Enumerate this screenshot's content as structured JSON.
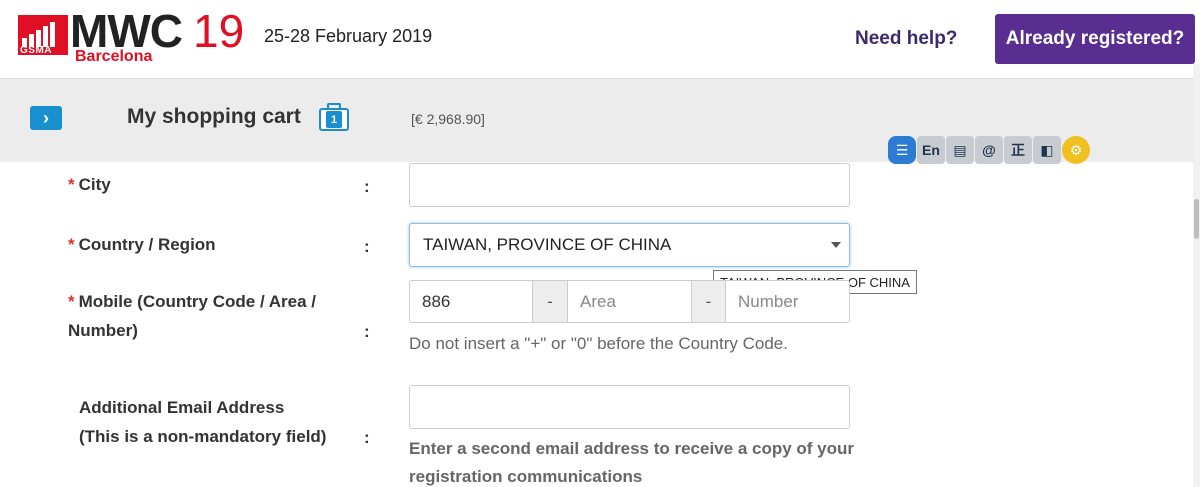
{
  "header": {
    "logo": {
      "org": "GSMA",
      "brand": "MWC",
      "year": "19",
      "city": "Barcelona"
    },
    "event_date": "25-28 February 2019",
    "need_help": "Need help?",
    "already_registered": "Already registered?"
  },
  "cart": {
    "title": "My shopping cart",
    "item_count": "1",
    "total": "[€ 2,968.90]"
  },
  "toolbar": {
    "items": [
      {
        "icon": "document-icon",
        "glyph": "☰"
      },
      {
        "icon": "english-icon",
        "glyph": "En"
      },
      {
        "icon": "list-icon",
        "glyph": "▤"
      },
      {
        "icon": "at-icon",
        "glyph": "@"
      },
      {
        "icon": "correct-icon",
        "glyph": "正"
      },
      {
        "icon": "contrast-icon",
        "glyph": "◧"
      },
      {
        "icon": "settings-icon",
        "glyph": "⚙"
      }
    ]
  },
  "form": {
    "city": {
      "required": "*",
      "label": "City",
      "colon": ":",
      "value": ""
    },
    "country": {
      "required": "*",
      "label": "Country / Region",
      "colon": ":",
      "value": "TAIWAN, PROVINCE OF CHINA",
      "tooltip": "TAIWAN, PROVINCE OF CHINA"
    },
    "mobile": {
      "required": "*",
      "label_line1": "Mobile (Country Code / Area /",
      "label_line2": "Number)",
      "colon": ":",
      "country_code": "886",
      "separator": "-",
      "area_placeholder": "Area",
      "number_placeholder": "Number",
      "help": "Do not insert a \"+\" or \"0\" before the Country Code."
    },
    "additional_email": {
      "label_line1": "Additional Email Address",
      "label_line2": "(This is a non-mandatory field)",
      "colon": ":",
      "value": "",
      "help_line1": "Enter a second email address to receive a copy of your",
      "help_line2": "registration communications"
    }
  },
  "colors": {
    "brand_red": "#e10f23",
    "accent_purple": "#5a2d91",
    "link_blue": "#1a8fd0"
  }
}
